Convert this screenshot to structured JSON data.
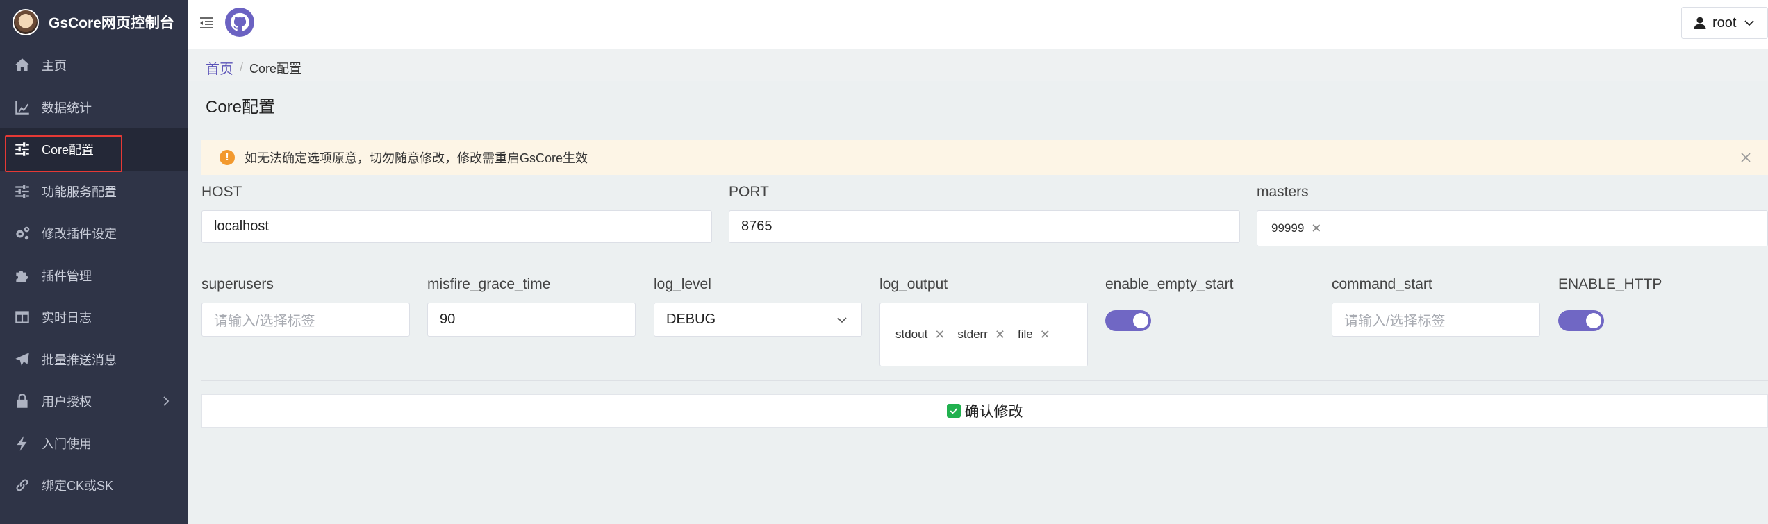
{
  "brand": {
    "title": "GsCore网页控制台"
  },
  "sidebar": {
    "items": [
      {
        "label": "主页",
        "icon": "home-icon"
      },
      {
        "label": "数据统计",
        "icon": "chart-icon"
      },
      {
        "label": "Core配置",
        "icon": "sliders-icon",
        "active": true
      },
      {
        "label": "功能服务配置",
        "icon": "sliders-icon"
      },
      {
        "label": "修改插件设定",
        "icon": "gears-icon"
      },
      {
        "label": "插件管理",
        "icon": "puzzle-icon"
      },
      {
        "label": "实时日志",
        "icon": "columns-icon"
      },
      {
        "label": "批量推送消息",
        "icon": "paper-plane-icon"
      },
      {
        "label": "用户授权",
        "icon": "lock-icon",
        "has_submenu": true
      },
      {
        "label": "入门使用",
        "icon": "bolt-icon"
      },
      {
        "label": "绑定CK或SK",
        "icon": "link-icon"
      }
    ]
  },
  "header": {
    "user": "root"
  },
  "breadcrumb": {
    "home": "首页",
    "separator": "/",
    "current": "Core配置"
  },
  "page": {
    "title": "Core配置"
  },
  "alert": {
    "text": "如无法确定选项原意，切勿随意修改，修改需重启GsCore生效"
  },
  "form": {
    "host": {
      "label": "HOST",
      "value": "localhost"
    },
    "port": {
      "label": "PORT",
      "value": "8765"
    },
    "masters": {
      "label": "masters",
      "tags": [
        "99999"
      ]
    },
    "superusers": {
      "label": "superusers",
      "placeholder": "请输入/选择标签"
    },
    "misfire_grace_time": {
      "label": "misfire_grace_time",
      "value": "90"
    },
    "log_level": {
      "label": "log_level",
      "value": "DEBUG"
    },
    "log_output": {
      "label": "log_output",
      "tags": [
        "stdout",
        "stderr",
        "file"
      ]
    },
    "enable_empty_start": {
      "label": "enable_empty_start",
      "on": true
    },
    "command_start": {
      "label": "command_start",
      "placeholder": "请输入/选择标签"
    },
    "enable_http": {
      "label": "ENABLE_HTTP",
      "on": true
    }
  },
  "confirm": {
    "label": "确认修改"
  },
  "colors": {
    "sidebar_bg": "#2f3447",
    "accent": "#7067c4",
    "alert_bg": "#fdf5e6",
    "warn": "#f2992e",
    "success": "#21b14f"
  }
}
